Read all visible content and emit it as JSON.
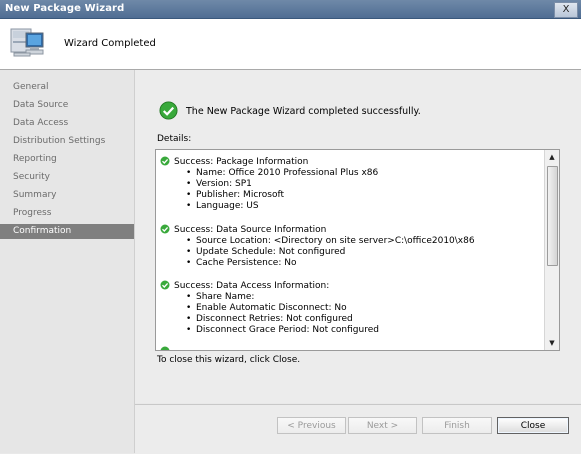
{
  "window": {
    "title": "New Package Wizard",
    "close_glyph": "X"
  },
  "header": {
    "title": "Wizard Completed",
    "icon": "computer-icon"
  },
  "sidebar": {
    "items": [
      {
        "label": "General"
      },
      {
        "label": "Data Source"
      },
      {
        "label": "Data Access"
      },
      {
        "label": "Distribution Settings"
      },
      {
        "label": "Reporting"
      },
      {
        "label": "Security"
      },
      {
        "label": "Summary"
      },
      {
        "label": "Progress"
      },
      {
        "label": "Confirmation",
        "active": true
      }
    ]
  },
  "main": {
    "success_text": "The New Package Wizard completed successfully.",
    "details_label": "Details:",
    "sections": [
      {
        "heading": "Success: Package Information",
        "items": [
          "Name: Office 2010 Professional Plus x86",
          "Version: SP1",
          "Publisher: Microsoft",
          "Language: US"
        ]
      },
      {
        "heading": "Success: Data Source Information",
        "items": [
          "Source Location: <Directory on site server>C:\\office2010\\x86",
          "Update Schedule: Not configured",
          "Cache Persistence: No"
        ]
      },
      {
        "heading": "Success: Data Access Information:",
        "items": [
          "Share Name:",
          "Enable Automatic Disconnect: No",
          "Disconnect Retries: Not configured",
          "Disconnect Grace Period: Not configured"
        ]
      }
    ],
    "close_note": "To close this wizard, click Close."
  },
  "buttons": {
    "previous": "< Previous",
    "next": "Next >",
    "finish": "Finish",
    "close": "Close"
  },
  "colors": {
    "titlebar": "#5a7599",
    "success_green": "#2f9f2f",
    "active_item": "#7f7f7f"
  }
}
